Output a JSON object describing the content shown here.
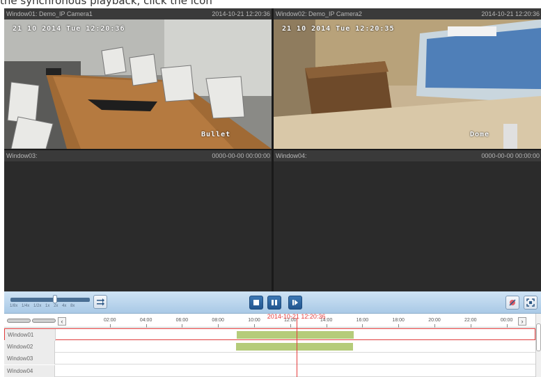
{
  "caption": {
    "text": "the synchronous playback, click the icon"
  },
  "panes": [
    {
      "title": "Window01: Demo_IP Camera1",
      "timestamp": "2014-10-21 12:20:36",
      "osd_time": "21 10 2014 Tue 12:20:36",
      "osd_name": "Bullet"
    },
    {
      "title": "Window02: Demo_IP Camera2",
      "timestamp": "2014-10-21 12:20:36",
      "osd_time": "21 10 2014 Tue 12:20:35",
      "osd_name": "Dome"
    },
    {
      "title": "Window03:",
      "timestamp": "0000-00-00 00:00:00"
    },
    {
      "title": "Window04:",
      "timestamp": "0000-00-00 00:00:00"
    }
  ],
  "speed": {
    "labels": [
      "1/8x",
      "1/4x",
      "1/2x",
      "1x",
      "2x",
      "4x",
      "8x"
    ],
    "current": "1x"
  },
  "controls": {
    "stop_icon": "stop-icon",
    "pause_icon": "pause-icon",
    "step_icon": "single-frame-icon",
    "sync_icon": "sync-icon",
    "clip_icon": "clip-icon",
    "fullscreen_icon": "fullscreen-icon"
  },
  "timeline": {
    "ticks": [
      "02:00",
      "04:00",
      "06:00",
      "08:00",
      "10:00",
      "12:00",
      "14:00",
      "16:00",
      "18:00",
      "20:00",
      "22:00",
      "00:00"
    ],
    "cursor_label": "2014-10-21 12:20:36",
    "cursor_time_hours": 12.34,
    "tracks": [
      {
        "label": "Window01",
        "selected": true,
        "recordings": [
          {
            "start_hour": 9.0,
            "end_hour": 15.5
          }
        ]
      },
      {
        "label": "Window02",
        "selected": false,
        "recordings": [
          {
            "start_hour": 9.0,
            "end_hour": 15.5
          }
        ]
      },
      {
        "label": "Window03",
        "selected": false,
        "recordings": []
      },
      {
        "label": "Window04",
        "selected": false,
        "recordings": []
      }
    ],
    "recording_color": "#b5cc7a",
    "cursor_color": "#e53b3b"
  }
}
